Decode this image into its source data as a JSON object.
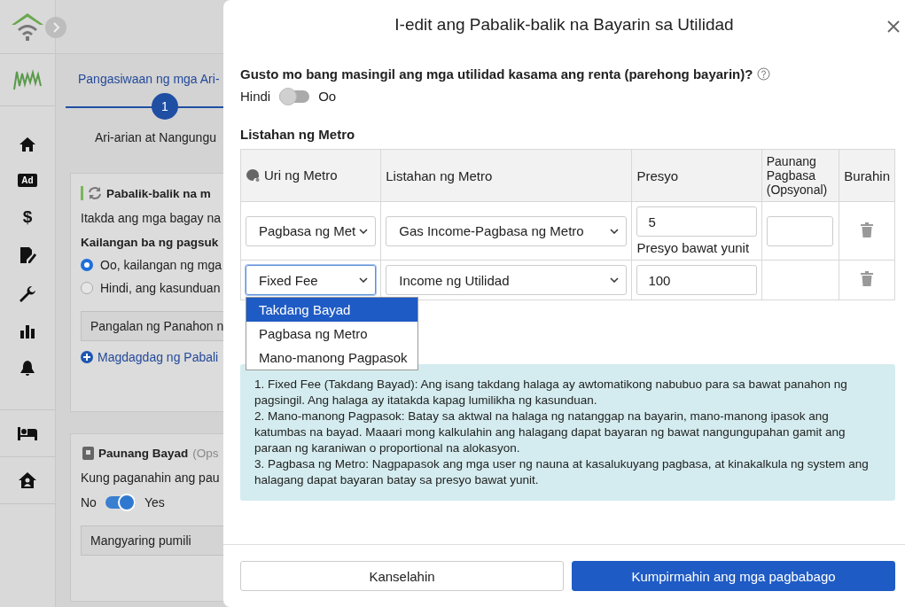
{
  "sidebar": {
    "ad_label": "Ad",
    "currency_symbol": "$"
  },
  "background": {
    "breadcrumb": "Pangasiwaan ng mga Ari-",
    "step": {
      "number": "1",
      "label": "Ari-arian at Nangungu"
    },
    "recurring_card": {
      "title": "Pabalik-balik na m",
      "description": "Itakda ang mga bagay na",
      "question": "Kailangan ba ng pagsuk",
      "options": [
        {
          "label": "Oo, kailangan ng mga",
          "selected": true
        },
        {
          "label": "Hindi, ang kasunduan",
          "selected": false
        }
      ],
      "period_field": {
        "value": "Pangalan ng Panahon n"
      },
      "add_link": "Magdagdag ng Pabali"
    },
    "deposit_card": {
      "title": "Paunang Bayad",
      "title_note": "(Ops",
      "question": "Kung paganahin ang pau",
      "toggle": {
        "off_label": "No",
        "on_label": "Yes",
        "on": true
      },
      "select": {
        "value": "Mangyaring pumili"
      }
    }
  },
  "modal": {
    "title": "I-edit ang Pabalik-balik na Bayarin sa Utilidad",
    "question": "Gusto mo bang masingil ang mga utilidad kasama ang renta (parehong bayarin)?",
    "toggle": {
      "off_label": "Hindi",
      "on_label": "Oo",
      "on": false
    },
    "section_title": "Listahan ng Metro",
    "table": {
      "columns": [
        "Uri ng Metro",
        "Listahan ng Metro",
        "Presyo",
        "Paunang Pagbasa (Opsyonal)",
        "Burahin"
      ],
      "rows": [
        {
          "meter_type": "Pagbasa ng Met",
          "focused": false,
          "meter_list": "Gas Income-Pagbasa ng Metro",
          "price": "5",
          "price_hint": "Presyo bawat yunit",
          "initial_reading_field": true
        },
        {
          "meter_type": "Fixed Fee",
          "focused": true,
          "meter_list": "Income ng Utilidad",
          "price": "100",
          "initial_reading_field": false
        }
      ],
      "dropdown": {
        "options": [
          {
            "label": "Takdang Bayad",
            "selected": true
          },
          {
            "label": "Pagbasa ng Metro",
            "selected": false
          },
          {
            "label": "Mano-manong Pagpasok",
            "selected": false
          }
        ]
      }
    },
    "info": [
      "1. Fixed Fee (Takdang Bayad): Ang isang takdang halaga ay awtomatikong nabubuo para sa bawat panahon ng pagsingil. Ang halaga ay itatakda kapag lumilikha ng kasunduan.",
      "2. Mano-manong Pagpasok: Batay sa aktwal na halaga ng natanggap na bayarin, mano-manong ipasok ang katumbas na bayad. Maaari mong kalkulahin ang halagang dapat bayaran ng bawat nangungupahan gamit ang paraan ng karaniwan o proportional na alokasyon.",
      "3. Pagbasa ng Metro: Nagpapasok ang mga user ng nauna at kasalukuyang pagbasa, at kinakalkula ng system ang halagang dapat bayaran batay sa presyo bawat yunit."
    ],
    "buttons": {
      "cancel": "Kanselahin",
      "confirm": "Kumpirmahin ang mga pagbabago"
    }
  }
}
